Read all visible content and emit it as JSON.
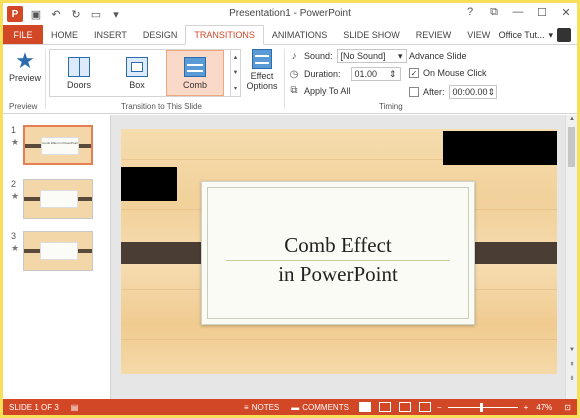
{
  "window": {
    "title": "Presentation1 - PowerPoint",
    "app_badge": "P",
    "controls": [
      "?",
      "⧉",
      "—",
      "☐",
      "✕"
    ]
  },
  "tabs": {
    "file": "FILE",
    "items": [
      "HOME",
      "INSERT",
      "DESIGN",
      "TRANSITIONS",
      "ANIMATIONS",
      "SLIDE SHOW",
      "REVIEW",
      "VIEW"
    ],
    "active": "TRANSITIONS",
    "user": "Office Tut..."
  },
  "ribbon": {
    "preview_label": "Preview",
    "preview_group": "Preview",
    "transitions_group": "Transition to This Slide",
    "transitions": [
      {
        "label": "Doors",
        "icon": "doors-icon"
      },
      {
        "label": "Box",
        "icon": "box-icon"
      },
      {
        "label": "Comb",
        "icon": "comb-icon"
      }
    ],
    "selected_transition": "Comb",
    "effect_options_line1": "Effect",
    "effect_options_line2": "Options",
    "timing_group": "Timing",
    "sound_label": "Sound:",
    "sound_value": "[No Sound]",
    "duration_label": "Duration:",
    "duration_value": "01.00",
    "apply_all_label": "Apply To All",
    "advance_label": "Advance Slide",
    "on_mouse_click_label": "On Mouse Click",
    "on_mouse_click_checked": true,
    "after_label": "After:",
    "after_value": "00:00.00",
    "after_checked": false
  },
  "slides_panel": {
    "slides": [
      {
        "num": "1",
        "star": "★",
        "selected": true,
        "thumb_text": "Comb Effect in PowerPoint"
      },
      {
        "num": "2",
        "star": "★",
        "selected": false,
        "thumb_text": ""
      },
      {
        "num": "3",
        "star": "★",
        "selected": false,
        "thumb_text": ""
      }
    ]
  },
  "slide": {
    "title_line1": "Comb Effect",
    "title_line2": "in PowerPoint"
  },
  "status": {
    "slide_info": "SLIDE 1 OF 3",
    "notes": "NOTES",
    "comments": "COMMENTS",
    "zoom": "47%",
    "zoom_level_fraction": 0.47
  }
}
